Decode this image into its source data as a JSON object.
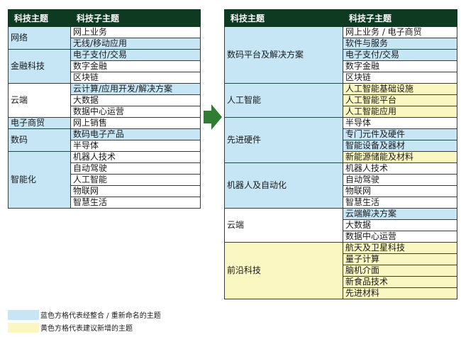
{
  "colors": {
    "header": "#0d3a20",
    "blue": "#c6e6f6",
    "yellow": "#fbf7c2",
    "arrow": "#2f7d32"
  },
  "left_table": {
    "header_theme": "科技主题",
    "header_sub": "科技子主题",
    "groups": [
      {
        "theme": "网络",
        "theme_color": "blue",
        "subs": [
          {
            "label": "网上业务",
            "color": "white"
          },
          {
            "label": "无线/移动应用",
            "color": "blue"
          }
        ]
      },
      {
        "theme": "金融科技",
        "theme_color": "blue",
        "subs": [
          {
            "label": "电子支付/交易",
            "color": "blue"
          },
          {
            "label": "数字金融",
            "color": "white"
          },
          {
            "label": "区块链",
            "color": "white"
          }
        ]
      },
      {
        "theme": "云端",
        "theme_color": "white",
        "subs": [
          {
            "label": "云计算/应用开发/解决方案",
            "color": "blue"
          },
          {
            "label": "大数据",
            "color": "white"
          },
          {
            "label": "数据中心运营",
            "color": "white"
          }
        ]
      },
      {
        "theme": "电子商贸",
        "theme_color": "blue",
        "subs": [
          {
            "label": "网上销售",
            "color": "white"
          }
        ]
      },
      {
        "theme": "数码",
        "theme_color": "blue",
        "subs": [
          {
            "label": "数码电子产品",
            "color": "blue"
          },
          {
            "label": "半导体",
            "color": "white"
          }
        ]
      },
      {
        "theme": "智能化",
        "theme_color": "blue",
        "subs": [
          {
            "label": "机器人技术",
            "color": "white"
          },
          {
            "label": "自动驾驶",
            "color": "white"
          },
          {
            "label": "人工智能",
            "color": "white"
          },
          {
            "label": "物联网",
            "color": "white"
          },
          {
            "label": "智慧生活",
            "color": "white"
          }
        ]
      }
    ]
  },
  "right_table": {
    "header_theme": "科技主题",
    "header_sub": "科技子主题",
    "groups": [
      {
        "theme": "数码平台及解决方案",
        "theme_color": "blue",
        "subs": [
          {
            "label": "网上业务 / 电子商贸",
            "color": "white"
          },
          {
            "label": "软件与服务",
            "color": "blue"
          },
          {
            "label": "电子支付/交易",
            "color": "blue"
          },
          {
            "label": "数字金融",
            "color": "white"
          },
          {
            "label": "区块链",
            "color": "white"
          }
        ]
      },
      {
        "theme": "人工智能",
        "theme_color": "blue",
        "subs": [
          {
            "label": "人工智能基础设施",
            "color": "yellow"
          },
          {
            "label": "人工智能平台",
            "color": "yellow"
          },
          {
            "label": "人工智能应用",
            "color": "yellow"
          }
        ]
      },
      {
        "theme": "先进硬件",
        "theme_color": "blue",
        "subs": [
          {
            "label": "半导体",
            "color": "white"
          },
          {
            "label": "专门元件及硬件",
            "color": "blue"
          },
          {
            "label": "智能设备及器材",
            "color": "blue"
          },
          {
            "label": "新能源储能及材料",
            "color": "yellow"
          }
        ]
      },
      {
        "theme": "机器人及自动化",
        "theme_color": "blue",
        "subs": [
          {
            "label": "机器人技术",
            "color": "white"
          },
          {
            "label": "自动驾驶",
            "color": "white"
          },
          {
            "label": "物联网",
            "color": "white"
          },
          {
            "label": "智慧生活",
            "color": "white"
          }
        ]
      },
      {
        "theme": "云端",
        "theme_color": "white",
        "subs": [
          {
            "label": "云端解决方案",
            "color": "blue"
          },
          {
            "label": "大数据",
            "color": "white"
          },
          {
            "label": "数据中心运营",
            "color": "white"
          }
        ]
      },
      {
        "theme": "前沿科技",
        "theme_color": "yellow",
        "subs": [
          {
            "label": "航天及卫星科技",
            "color": "yellow"
          },
          {
            "label": "量子计算",
            "color": "yellow"
          },
          {
            "label": "脑机介面",
            "color": "yellow"
          },
          {
            "label": "新食品技术",
            "color": "yellow"
          },
          {
            "label": "先进材料",
            "color": "yellow"
          }
        ]
      }
    ]
  },
  "legend": [
    {
      "color": "blue",
      "label": "蓝色方格代表经整合 / 重新命名的主题"
    },
    {
      "color": "yellow",
      "label": "黄色方格代表建议新增的主题"
    }
  ]
}
